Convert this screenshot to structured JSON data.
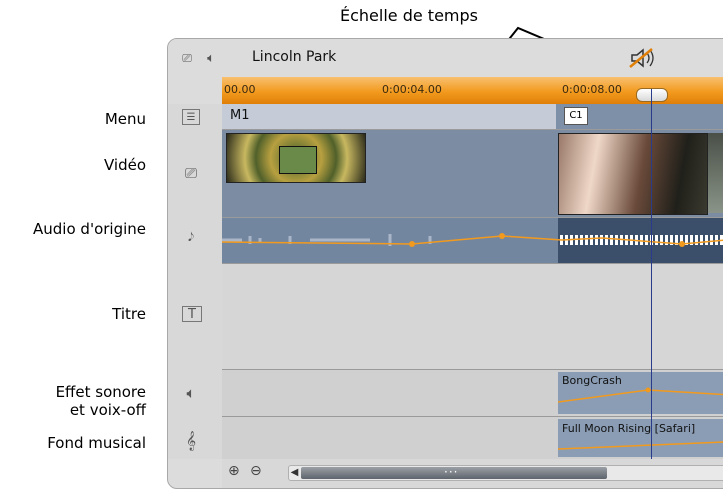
{
  "callouts": {
    "timescale": "Échelle de temps",
    "menu": "Menu",
    "video": "Vidéo",
    "original_audio": "Audio d'origine",
    "title": "Titre",
    "sound_effects_line1": "Effet sonore",
    "sound_effects_line2": "et voix-off",
    "background_music": "Fond musical"
  },
  "project": {
    "name": "Lincoln Park"
  },
  "ruler": {
    "ticks": [
      "00.00",
      "0:00:04.00",
      "0:00:08.00"
    ]
  },
  "tracks": {
    "menu_clips": [
      "M1",
      "C1"
    ],
    "sound_clip": "BongCrash",
    "music_clip": "Full Moon Rising [Safari]"
  },
  "icons": {
    "header_video": "video-track-icon",
    "header_audio": "speaker-icon",
    "header_mute": "mute-speaker-icon",
    "menu": "list-icon",
    "video": "video-track-icon",
    "audio": "guitar-icon",
    "title": "title-icon",
    "fx": "speaker-icon",
    "music": "treble-clef-icon",
    "zoom_in": "zoom-in-icon",
    "zoom_out": "zoom-out-icon"
  },
  "colors": {
    "ruler": "#f29a1e",
    "playhead": "#2b3b8c",
    "track_blue": "#7b8ca3"
  }
}
